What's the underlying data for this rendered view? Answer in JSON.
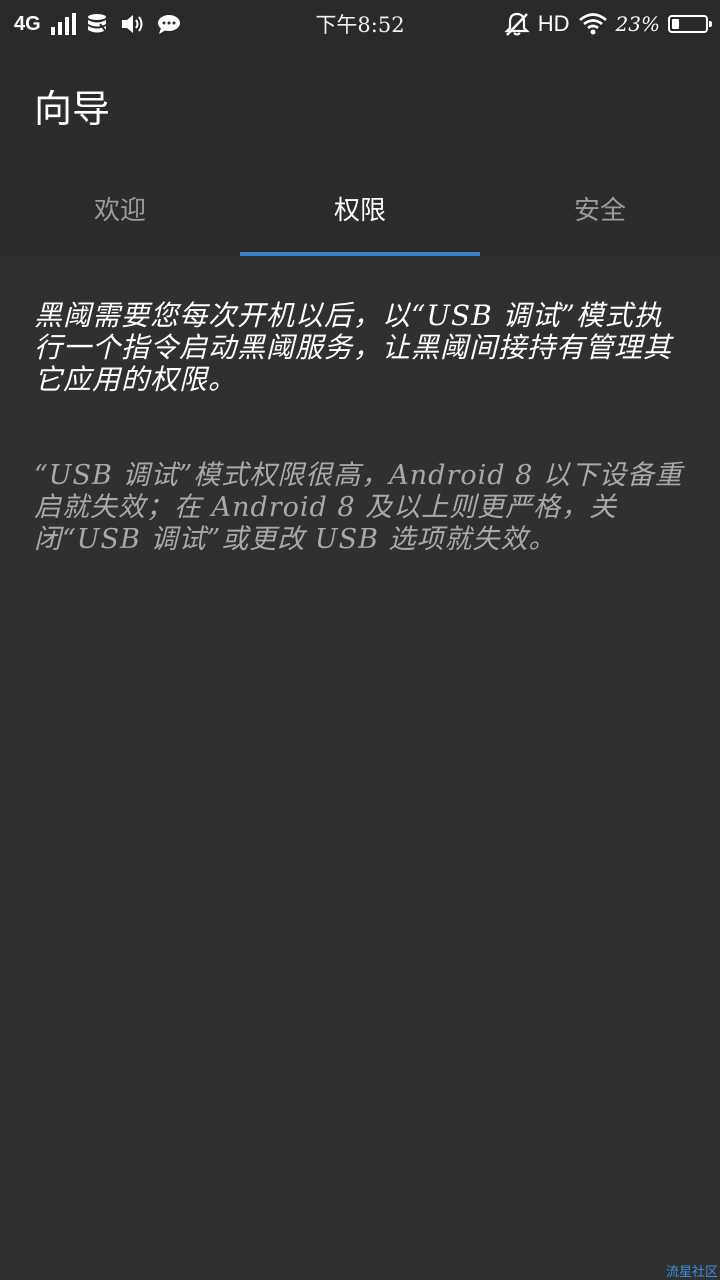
{
  "status_bar": {
    "network": "4G",
    "signal_level": 4,
    "time": "下午8:52",
    "hd": "HD",
    "battery_percent": "23%",
    "battery_level": 0.23,
    "icons": [
      "signal-icon",
      "data-icon",
      "volume-icon",
      "message-icon",
      "alarm-off-icon",
      "wifi-icon",
      "battery-icon"
    ]
  },
  "app": {
    "title": "向导"
  },
  "tabs": [
    {
      "label": "欢迎",
      "active": false
    },
    {
      "label": "权限",
      "active": true
    },
    {
      "label": "安全",
      "active": false
    }
  ],
  "content": {
    "paragraph1": "黑阈需要您每次开机以后，以“USB 调试”模式执行一个指令启动黑阈服务，让黑阈间接持有管理其它应用的权限。",
    "paragraph2": "“USB 调试”模式权限很高，Android 8 以下设备重启就失效；在 Android 8 及以上则更严格，关闭“USB 调试”或更改 USB 选项就失效。"
  },
  "watermark": "流星社区",
  "colors": {
    "background": "#303030",
    "appbar": "#2c2c2c",
    "accent": "#3d7fcb",
    "secondary_text": "#a9a9a9"
  }
}
